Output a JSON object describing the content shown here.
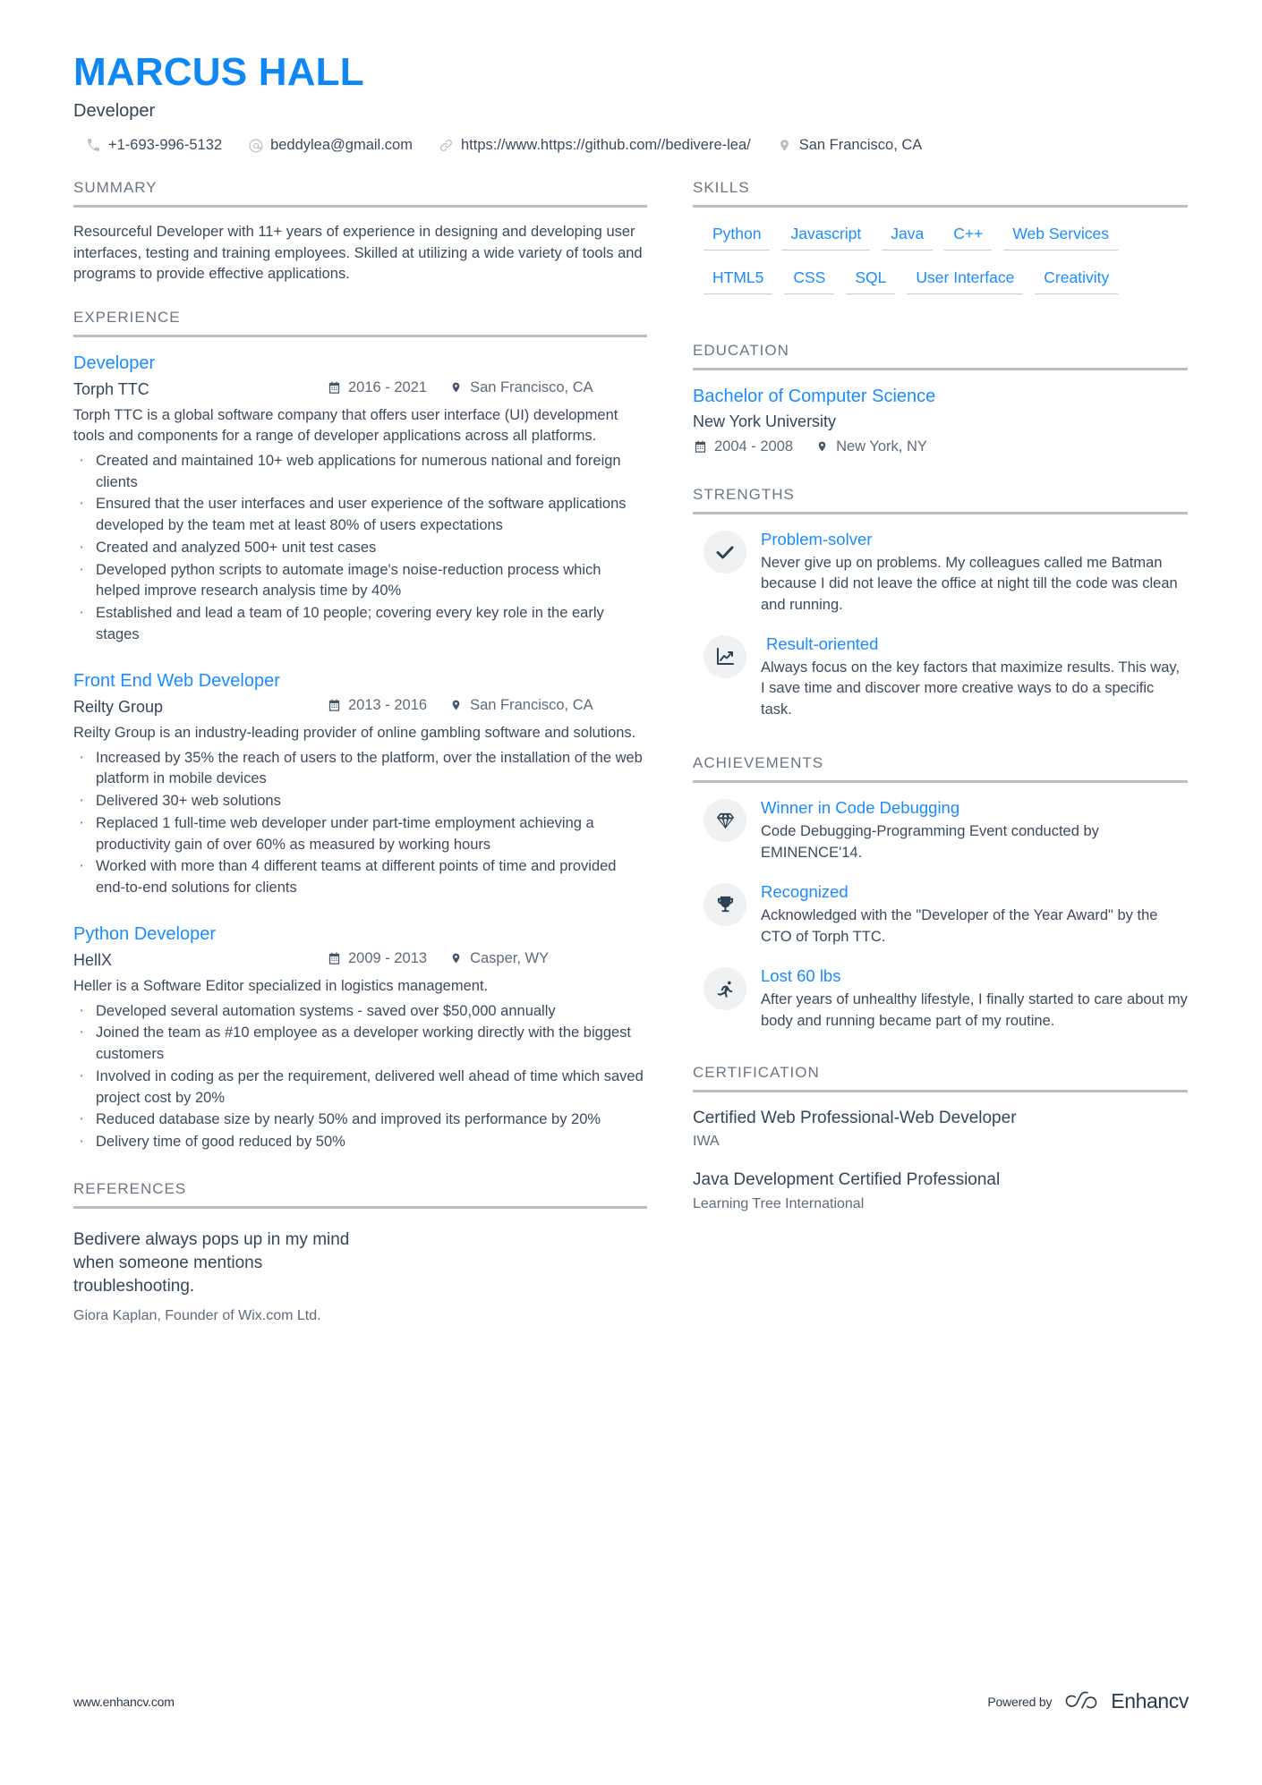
{
  "header": {
    "name": "MARCUS HALL",
    "job_title": "Developer",
    "contacts": [
      {
        "icon": "phone-icon",
        "value": "+1-693-996-5132"
      },
      {
        "icon": "email-icon",
        "value": "beddylea@gmail.com"
      },
      {
        "icon": "link-icon",
        "value": "https://www.https://github.com//bedivere-lea/"
      },
      {
        "icon": "location-icon",
        "value": "San Francisco, CA"
      }
    ]
  },
  "summary": {
    "title": "SUMMARY",
    "text": "Resourceful Developer with 11+ years of experience in designing and developing user interfaces, testing and training employees. Skilled at utilizing a wide variety of tools and programs to provide effective applications."
  },
  "experience": {
    "title": "EXPERIENCE",
    "jobs": [
      {
        "role": "Developer",
        "company": "Torph TTC",
        "dates": "2016 - 2021",
        "location": "San Francisco, CA",
        "description": "Torph TTC is a global software company that offers user interface (UI) development tools and components for a range of developer applications across all platforms.",
        "bullets": [
          "Created and maintained 10+ web applications for numerous national and foreign clients",
          "Ensured that the user interfaces and user experience of the software applications developed by the team met at least 80% of users expectations",
          "Created and analyzed 500+ unit test cases",
          "Developed python scripts to automate image's noise-reduction process which helped improve research analysis time by 40%",
          "Established and lead a team of 10 people; covering every key role in the early stages"
        ]
      },
      {
        "role": "Front End Web Developer",
        "company": "Reilty Group",
        "dates": "2013 - 2016",
        "location": "San Francisco, CA",
        "description": "Reilty Group is an industry-leading provider of online gambling software and solutions.",
        "bullets": [
          "Increased by 35% the reach of users to the platform, over the installation of the web platform in mobile devices",
          "Delivered 30+ web solutions",
          "Replaced 1 full-time web developer under part-time employment achieving a productivity gain of over 60% as measured by working hours",
          "Worked with more than 4 different teams at different points of time and provided end-to-end solutions for clients"
        ]
      },
      {
        "role": "Python Developer",
        "company": "HellX",
        "dates": "2009 - 2013",
        "location": "Casper, WY",
        "description": "Heller is a Software Editor specialized in logistics management.",
        "bullets": [
          "Developed several automation systems - saved over $50,000 annually",
          "Joined the team as #10 employee as a developer working directly with the biggest customers",
          "Involved in coding as per the requirement, delivered well ahead of time which saved project cost by 20%",
          "Reduced database size by nearly 50% and improved its performance by 20%",
          "Delivery time of good reduced by 50%"
        ]
      }
    ]
  },
  "references": {
    "title": "REFERENCES",
    "items": [
      {
        "quote": "Bedivere always pops up in my mind when someone mentions troubleshooting.",
        "author": "Giora Kaplan, Founder of Wix.com Ltd."
      }
    ]
  },
  "skills": {
    "title": "SKILLS",
    "items": [
      "Python",
      "Javascript",
      "Java",
      "C++",
      "Web Services",
      "HTML5",
      "CSS",
      "SQL",
      "User Interface",
      "Creativity"
    ]
  },
  "education": {
    "title": "EDUCATION",
    "items": [
      {
        "degree": "Bachelor of Computer Science",
        "school": "New York University",
        "dates": "2004 - 2008",
        "location": "New York, NY"
      }
    ]
  },
  "strengths": {
    "title": "STRENGTHS",
    "items": [
      {
        "icon": "check-icon",
        "title": "Problem-solver",
        "description": "Never give up on problems. My colleagues called me Batman because I did not leave the office at night till the code was clean and running."
      },
      {
        "icon": "chart-up-icon",
        "title": "Result-oriented",
        "description": "Always focus on the key factors that maximize results. This way, I save time and discover more creative ways to do a specific task."
      }
    ]
  },
  "achievements": {
    "title": "ACHIEVEMENTS",
    "items": [
      {
        "icon": "diamond-icon",
        "title": "Winner in Code Debugging",
        "description": "Code Debugging-Programming Event conducted by EMINENCE'14."
      },
      {
        "icon": "trophy-icon",
        "title": "Recognized",
        "description": "Acknowledged with the \"Developer of the Year Award\" by the CTO of Torph TTC."
      },
      {
        "icon": "running-icon",
        "title": "Lost 60 lbs",
        "description": "After years of unhealthy lifestyle, I finally started to care about my body and running became part of my routine."
      }
    ]
  },
  "certification": {
    "title": "CERTIFICATION",
    "items": [
      {
        "name": "Certified Web Professional-Web Developer",
        "org": "IWA"
      },
      {
        "name": "Java Development Certified Professional",
        "org": "Learning Tree International"
      }
    ]
  },
  "footer": {
    "url": "www.enhancv.com",
    "powered_by": "Powered by",
    "brand": "Enhancv"
  },
  "colors": {
    "accent": "#1a8cff",
    "name_blue": "#0f87f5",
    "text": "#33475b",
    "muted": "#6b7785",
    "rule": "#b9bfc6",
    "icon_bg": "#f0f1f3"
  }
}
